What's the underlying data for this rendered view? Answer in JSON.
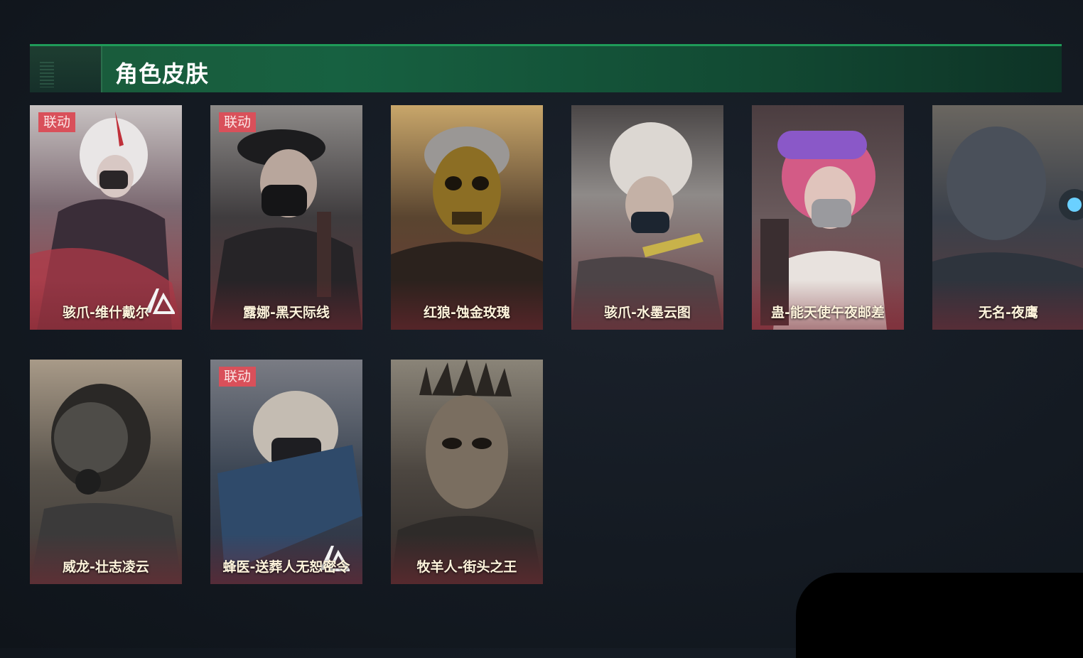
{
  "header": {
    "title": "角色皮肤"
  },
  "cards": [
    {
      "name": "骇爪-维什戴尔",
      "badge": "联动"
    },
    {
      "name": "露娜-黑天际线",
      "badge": "联动"
    },
    {
      "name": "红狼-蚀金玫瑰",
      "badge": ""
    },
    {
      "name": "骇爪-水墨云图",
      "badge": ""
    },
    {
      "name": "蛊-能天使午夜邮差",
      "badge": ""
    },
    {
      "name": "无名-夜鹰",
      "badge": ""
    },
    {
      "name": "威龙-壮志凌云",
      "badge": ""
    },
    {
      "name": "蜂医-送葬人无恕密令",
      "badge": "联动"
    },
    {
      "name": "牧羊人-街头之王",
      "badge": ""
    }
  ],
  "colors": {
    "accent": "#1f9b58",
    "badge": "#d9505a"
  }
}
